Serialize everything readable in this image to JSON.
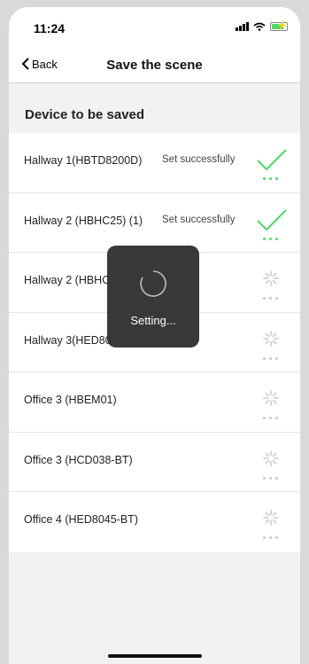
{
  "status_bar": {
    "time": "11:24"
  },
  "nav": {
    "back_label": "Back",
    "title": "Save the scene"
  },
  "section_title": "Device to be saved",
  "devices": [
    {
      "name": "Hallway 1(HBTD8200D)",
      "status": "Set successfully",
      "state": "success"
    },
    {
      "name": "Hallway 2 (HBHC25) (1)",
      "status": "Set successfully",
      "state": "success"
    },
    {
      "name": "Hallway 2 (HBHC",
      "status": "",
      "state": "pending"
    },
    {
      "name": "Hallway 3(HED80",
      "status": "",
      "state": "pending"
    },
    {
      "name": "Office 3 (HBEM01)",
      "status": "",
      "state": "pending"
    },
    {
      "name": "Office 3 (HCD038-BT)",
      "status": "",
      "state": "pending"
    },
    {
      "name": "Office 4 (HED8045-BT)",
      "status": "",
      "state": "pending"
    }
  ],
  "hud": {
    "label": "Setting..."
  },
  "colors": {
    "success": "#4cd964",
    "pending": "#c8c8c8"
  }
}
